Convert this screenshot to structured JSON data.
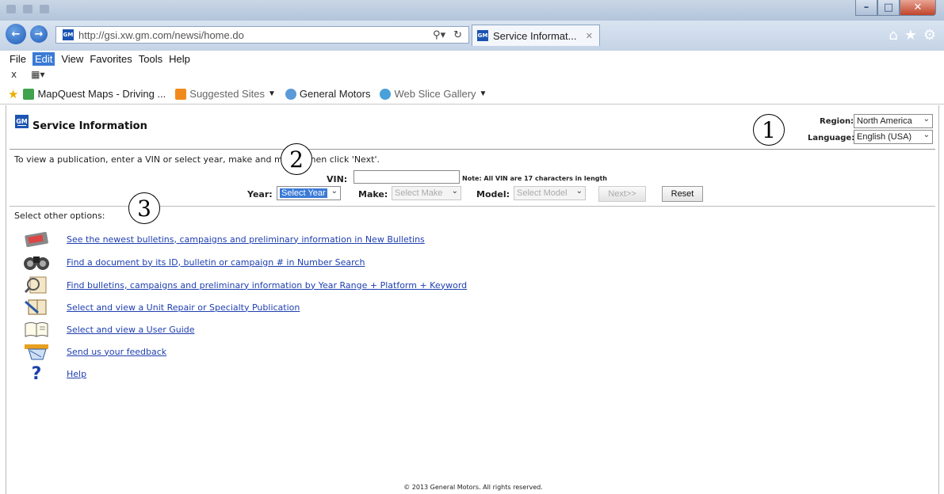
{
  "browser": {
    "url": "http://gsi.xw.gm.com/newsi/home.do",
    "tab_title": "Service Informat...",
    "menu": [
      "File",
      "Edit",
      "View",
      "Favorites",
      "Tools",
      "Help"
    ],
    "favorites": [
      "MapQuest Maps - Driving ...",
      "Suggested Sites",
      "General Motors",
      "Web Slice Gallery"
    ]
  },
  "header": {
    "logo_text": "GM",
    "title": "Service Information",
    "region_label": "Region:",
    "region_value": "North America",
    "language_label": "Language:",
    "language_value": "English (USA)"
  },
  "search": {
    "intro": "To view a publication, enter a VIN or select year, make and model, then click 'Next'.",
    "vin_label": "VIN:",
    "vin_value": "",
    "vin_note": "Note: All VIN are 17 characters in length",
    "year_label": "Year:",
    "year_value": "Select Year",
    "make_label": "Make:",
    "make_value": "Select Make",
    "model_label": "Model:",
    "model_value": "Select Model",
    "next_label": "Next>>",
    "reset_label": "Reset"
  },
  "options": {
    "label": "Select other options:",
    "items": [
      {
        "text": "See the newest bulletins, campaigns and preliminary information in New Bulletins",
        "icon": "calendar-icon"
      },
      {
        "text": "Find a document by its ID, bulletin or campaign # in Number Search",
        "icon": "binoculars-icon"
      },
      {
        "text": "Find bulletins, campaigns and preliminary information by Year Range + Platform + Keyword",
        "icon": "magnifier-document-icon"
      },
      {
        "text": "Select and view a Unit Repair or Specialty Publication",
        "icon": "repair-book-icon"
      },
      {
        "text": "Select and view a User Guide",
        "icon": "open-book-icon"
      },
      {
        "text": "Send us your feedback",
        "icon": "feedback-icon"
      },
      {
        "text": "Help",
        "icon": "help-icon"
      }
    ]
  },
  "footer": {
    "text": "© 2013 General Motors.  All rights reserved."
  },
  "callouts": {
    "one": "1",
    "two": "2",
    "three": "3"
  }
}
